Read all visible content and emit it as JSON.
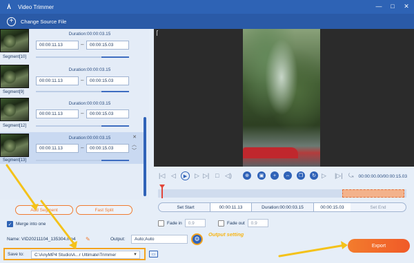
{
  "app": {
    "title": "Video Trimmer",
    "logo_icon": "logo-icon"
  },
  "window_controls": {
    "minimize": "—",
    "restore": "□",
    "close": "✕"
  },
  "source": {
    "label": "Change Source File"
  },
  "segments": [
    {
      "label": "Segment[10]",
      "duration": "Duration:00:00:03.15",
      "start": "00:00:11.13",
      "end": "00:00:15.03"
    },
    {
      "label": "Segment[9]",
      "duration": "Duration:00:00:03.15",
      "start": "00:00:11.13",
      "end": "00:00:15.03"
    },
    {
      "label": "Segment[12]",
      "duration": "Duration:00:00:03.15",
      "start": "00:00:11.13",
      "end": "00:00:15.03"
    },
    {
      "label": "Segment[13]",
      "duration": "Duration:00:00:03.15",
      "start": "00:00:11.13",
      "end": "00:00:15.03"
    }
  ],
  "buttons": {
    "add_segment": "Add Segment",
    "fast_split": "Fast Split",
    "export": "Export"
  },
  "merge": {
    "label": "Merge into one",
    "checked": true
  },
  "player": {
    "timecode": "00:00:00.00/00:00:15.03"
  },
  "trim": {
    "set_start": "Set Start",
    "start": "00:00:11.13",
    "duration": "Duration:00:00:03.15",
    "end": "00:00:15.03",
    "set_end": "Set End"
  },
  "fade": {
    "in_label": "Fade in",
    "in_value": "0.9",
    "out_label": "Fade out",
    "out_value": "0.9"
  },
  "output": {
    "name_label": "Name:",
    "name_value": "VID20211104_135304.mp4",
    "output_label": "Output:",
    "output_value": "Auto;Auto",
    "save_label": "Save to:",
    "save_value": "C:\\AnyMP4 Studio\\A...r Ultimate\\Trimmer"
  },
  "annotations": {
    "output_setting": "Output setting"
  },
  "colors": {
    "accent": "#2e63b5",
    "export": "#f05a28",
    "highlight": "#f4a31d"
  }
}
